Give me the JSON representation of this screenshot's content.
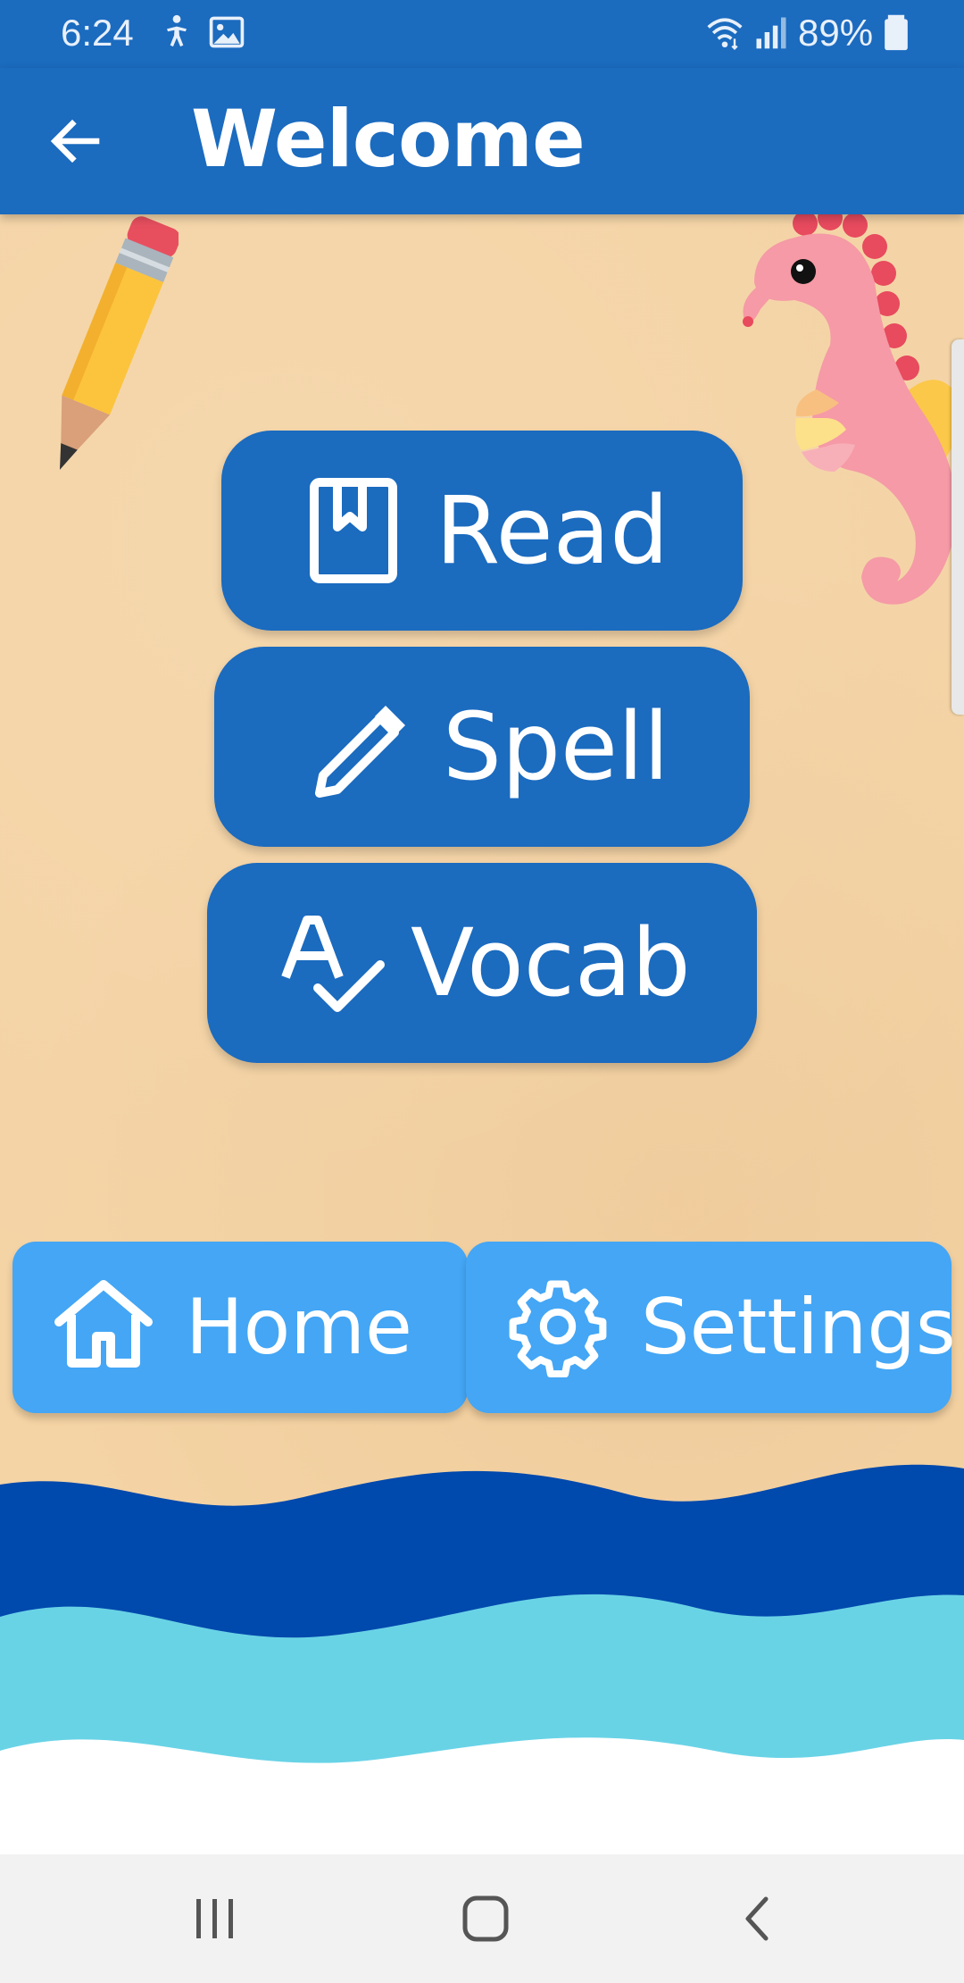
{
  "status_bar": {
    "time": "6:24",
    "battery": "89%",
    "icons": [
      "accessibility-icon",
      "gallery-icon",
      "wifi-icon",
      "signal-icon",
      "battery-icon"
    ]
  },
  "app_bar": {
    "title": "Welcome",
    "back_icon": "arrow-left-icon"
  },
  "menu": {
    "read": {
      "label": "Read",
      "icon": "book-icon"
    },
    "spell": {
      "label": "Spell",
      "icon": "pencil-icon"
    },
    "vocab": {
      "label": "Vocab",
      "icon": "spellcheck-icon"
    }
  },
  "bottom_nav": {
    "home": {
      "label": "Home",
      "icon": "home-icon"
    },
    "settings": {
      "label": "Settings",
      "icon": "gear-icon"
    }
  },
  "system_nav": [
    "recent-apps-icon",
    "home-circle-icon",
    "back-chevron-icon"
  ],
  "colors": {
    "primary": "#1b6bbf",
    "accent": "#44a6f5",
    "sand": "#f4d3a4",
    "wave_dark": "#0049ad",
    "wave_light": "#69d3e6"
  }
}
